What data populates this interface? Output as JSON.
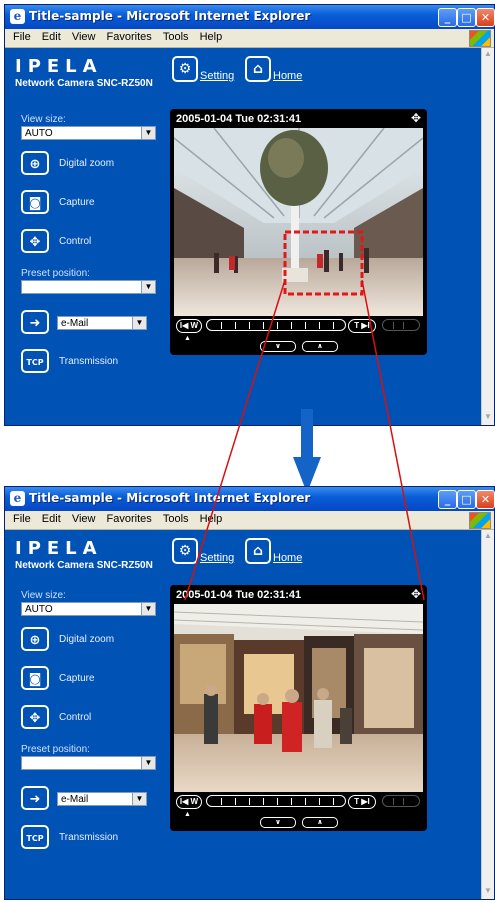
{
  "window": {
    "title": "Title-sample - Microsoft Internet Explorer",
    "minimize": "_",
    "maximize": "□",
    "close": "✕",
    "icon_glyph": "e"
  },
  "menu": [
    "File",
    "Edit",
    "View",
    "Favorites",
    "Tools",
    "Help"
  ],
  "brand": {
    "logo": "IPELA",
    "model": "Network Camera SNC-RZ50N"
  },
  "header_links": {
    "setting": "Setting",
    "home": "Home",
    "setting_icon": "⚙",
    "home_icon": "⌂"
  },
  "left_panel": {
    "view_size_label": "View size:",
    "view_size_value": "AUTO",
    "digital_zoom": "Digital zoom",
    "digital_zoom_icon": "⊕",
    "capture": "Capture",
    "capture_icon": "◙",
    "control": "Control",
    "control_icon": "✥",
    "preset_label": "Preset position:",
    "preset_value": "",
    "send_value": "e-Mail",
    "send_icon": "➜",
    "transmission": "Transmission",
    "transmission_icon": "TCP"
  },
  "dropdown_glyph": "▼",
  "viewer": {
    "timestamp": "2005-01-04 Tue 02:31:41",
    "move_icon": "✥",
    "zoom_wide": "I◀ W",
    "zoom_tele": "T ▶I",
    "zoom_tele_dim": "T▶I",
    "nav_down": "∨",
    "nav_up": "∧",
    "pointer": "▲"
  },
  "colors": {
    "page_blue": "#0052b5",
    "highlight_red": "#e01818",
    "line_red": "#d81010",
    "arrow_blue": "#1464c8"
  }
}
